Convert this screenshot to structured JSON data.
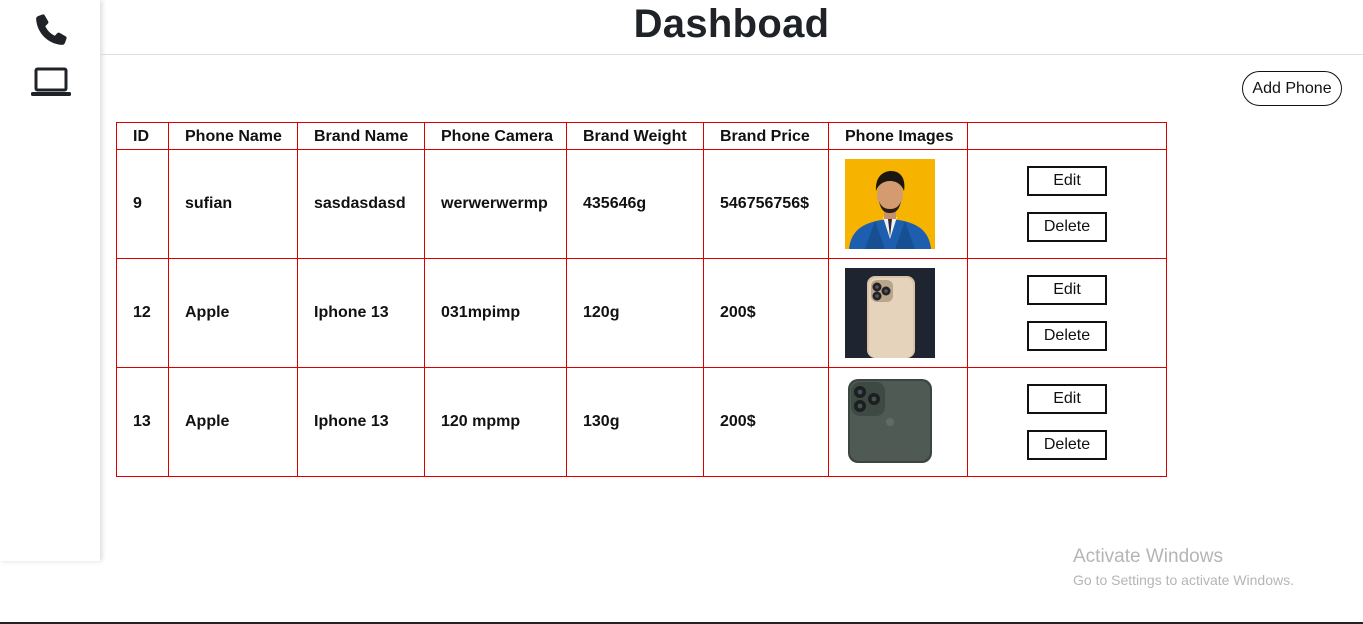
{
  "header": {
    "title": "Dashboad"
  },
  "sidebar": {
    "items": [
      {
        "icon": "phone-icon"
      },
      {
        "icon": "laptop-icon"
      }
    ]
  },
  "toolbar": {
    "add_label": "Add Phone"
  },
  "table": {
    "headers": [
      "ID",
      "Phone Name",
      "Brand Name",
      "Phone Camera",
      "Brand Weight",
      "Brand Price",
      "Phone Images",
      ""
    ],
    "rows": [
      {
        "id": "9",
        "phone_name": "sufian",
        "brand_name": "sasdasdasd",
        "camera": "werwerwermp",
        "weight": "435646g",
        "price": "546756756$",
        "image": "person-photo",
        "edit_label": "Edit",
        "delete_label": "Delete"
      },
      {
        "id": "12",
        "phone_name": "Apple",
        "brand_name": "Iphone 13",
        "camera": "031mpimp",
        "weight": "120g",
        "price": "200$",
        "image": "gold-phone-photo",
        "edit_label": "Edit",
        "delete_label": "Delete"
      },
      {
        "id": "13",
        "phone_name": "Apple",
        "brand_name": "Iphone 13",
        "camera": "120 mpmp",
        "weight": "130g",
        "price": "200$",
        "image": "green-phone-photo",
        "edit_label": "Edit",
        "delete_label": "Delete"
      }
    ]
  },
  "watermark": {
    "title": "Activate Windows",
    "subtitle": "Go to Settings to activate Windows."
  },
  "colors": {
    "table_border": "#d90000",
    "title": "#1f2328",
    "watermark": "#b5b5b5"
  }
}
